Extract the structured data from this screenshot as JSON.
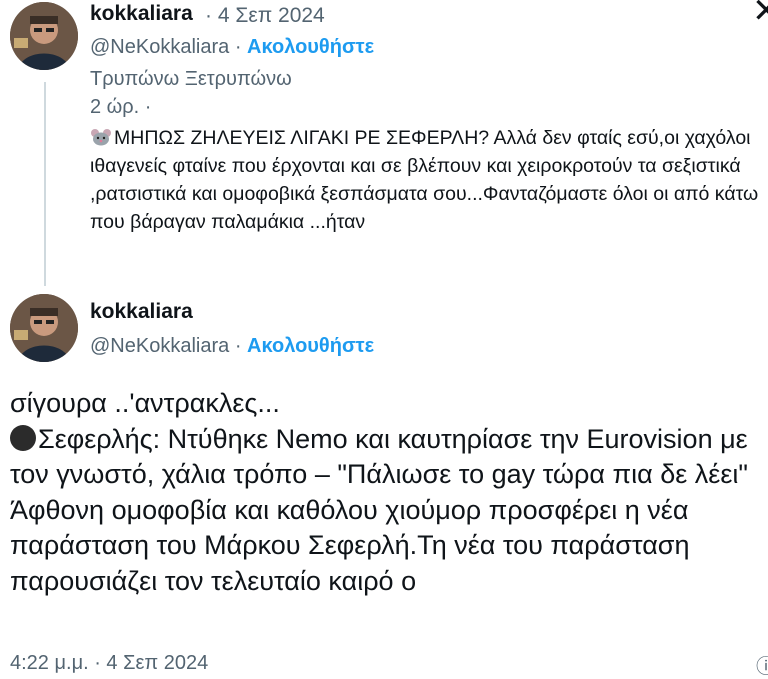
{
  "tweet1": {
    "display_name": "kokkaliara",
    "date": "4 Σεπ 2024",
    "handle": "@NeKokkaliara",
    "follow_label": "Ακολουθήστε",
    "quoted_name": "Τρυπώνω Ξετρυπώνω",
    "quoted_time": "2 ώρ.  ·",
    "mouse_icon": "mouse-icon",
    "quoted_text": "ΜΗΠΩΣ ΖΗΛΕΥΕΙΣ ΛΙΓΑΚΙ ΡΕ ΣΕΦΕΡΛΗ? Αλλά δεν φταίς  εσύ,οι χαχόλοι ιθαγενείς φταίνε που έρχονται και σε  βλέπουν και χειροκροτούν  τα σεξιστικά ,ρατσιστικά  και ομοφοβικά ξεσπάσματα σου...Φανταζόμαστε  όλοι οι από κάτω  που βάραγαν  παλαμάκια ...ήταν"
  },
  "tweet2": {
    "display_name": "kokkaliara",
    "handle": "@NeKokkaliara",
    "follow_label": "Ακολουθήστε",
    "line1": "σίγουρα ..'αντρακλες...",
    "line2": "Σεφερλής: Ντύθηκε Nemo και καυτηρίασε την Eurovision με τον γνωστό, χάλια τρόπο – \"Πάλιωσε το gay τώρα πια δε λέει\"",
    "line3": "Άφθονη ομοφοβία και καθόλου χιούμορ προσφέρει η νέα παράσταση του Μάρκου Σεφερλή.Τη νέα του παράσταση παρουσιάζει τον τελευταίο καιρό ο",
    "timestamp": "4:22 μ.μ. · 4 Σεπ 2024"
  },
  "sep": "·",
  "close_icon": "close-icon",
  "colors": {
    "follow": "#1d9bf0",
    "muted": "#536471",
    "text": "#0f1419"
  }
}
